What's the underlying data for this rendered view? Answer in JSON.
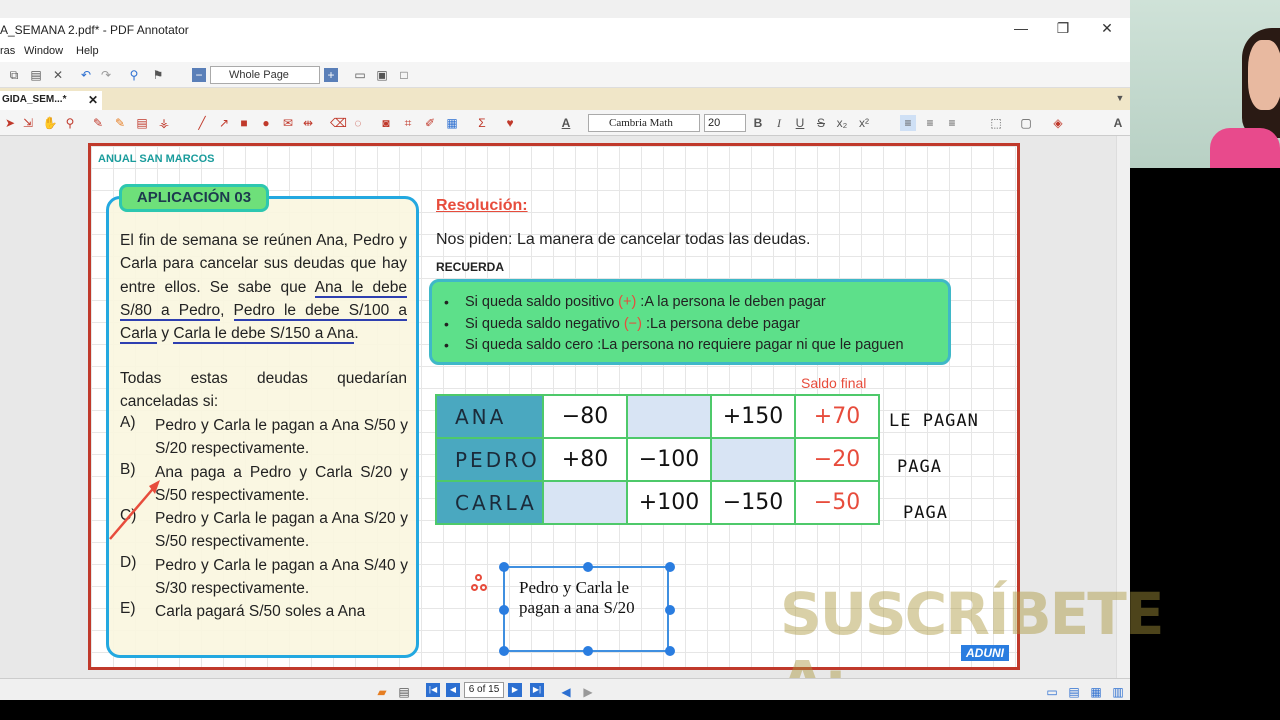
{
  "window": {
    "title": "A_SEMANA 2.pdf* - PDF Annotator",
    "minimize": "—",
    "restore": "❐",
    "close": "✕"
  },
  "menu": [
    "ras",
    "Window",
    "Help"
  ],
  "toolbar1": {
    "zoom": "Whole Page"
  },
  "tab": {
    "label": "GIDA_SEM...*",
    "close": "✕"
  },
  "toolbar2": {
    "font": "Cambria Math",
    "size": "20",
    "bold": "B",
    "italic": "I",
    "underline": "U",
    "strike": "S",
    "sub": "x₂",
    "sup": "x²"
  },
  "page": {
    "brand": "ANUAL SAN MARCOS",
    "app_title": "APLICACIÓN  03",
    "problem": {
      "l1": "El fin de semana se reúnen Ana, Pedro y Carla para cancelar sus deudas que hay entre ellos. Se sabe que ",
      "u1": "Ana le debe S/80 a Pedro",
      "s1": ", ",
      "u2": "Pedro le debe S/100 a Carla",
      "s2": " y ",
      "u3": "Carla le debe S/150 a Ana",
      "s3": ".",
      "l2": "Todas estas deudas quedarían canceladas si:"
    },
    "options": [
      {
        "letter": "A)",
        "text": "Pedro y Carla le pagan a Ana S/50 y S/20 respectivamente."
      },
      {
        "letter": "B)",
        "text": "Ana paga a Pedro y Carla S/20 y S/50 respectivamente."
      },
      {
        "letter": "C)",
        "text": "Pedro y Carla le pagan a Ana S/20 y S/50 respectivamente."
      },
      {
        "letter": "D)",
        "text": "Pedro y Carla le pagan a Ana S/40 y S/30 respectivamente."
      },
      {
        "letter": "E)",
        "text": "Carla pagará S/50 soles a Ana"
      }
    ],
    "resolucion": "Resolución:",
    "nos_label": "Nos piden:",
    "nos_text": " La manera de cancelar todas las deudas.",
    "recuerda": "RECUERDA",
    "rules": [
      {
        "a": "Si queda saldo positivo ",
        "sign": "(+)",
        "b": " :A la persona le deben pagar"
      },
      {
        "a": "Si queda saldo negativo ",
        "sign": "(−)",
        "b": " :La persona debe pagar"
      },
      {
        "a": "Si queda saldo cero :La persona no requiere pagar ni que le paguen",
        "sign": "",
        "b": ""
      }
    ],
    "saldo_final": "Saldo final",
    "table": [
      {
        "name": "ANA",
        "c1": "−80",
        "c2": "",
        "c3": "+150",
        "res": "+70",
        "note": "LE PAGAN"
      },
      {
        "name": "PEDRO",
        "c1": "+80",
        "c2": "−100",
        "c3": "",
        "res": "−20",
        "note": "PAGA"
      },
      {
        "name": "CARLA",
        "c1": "",
        "c2": "+100",
        "c3": "−150",
        "res": "−50",
        "note": "PAGA"
      }
    ],
    "answer_text": "Pedro y Carla le pagan a ana S/20",
    "aduni": "ADUNI"
  },
  "status": {
    "page_indicator": "6 of 15"
  },
  "watermark": "SUSCRÍBETE A:"
}
